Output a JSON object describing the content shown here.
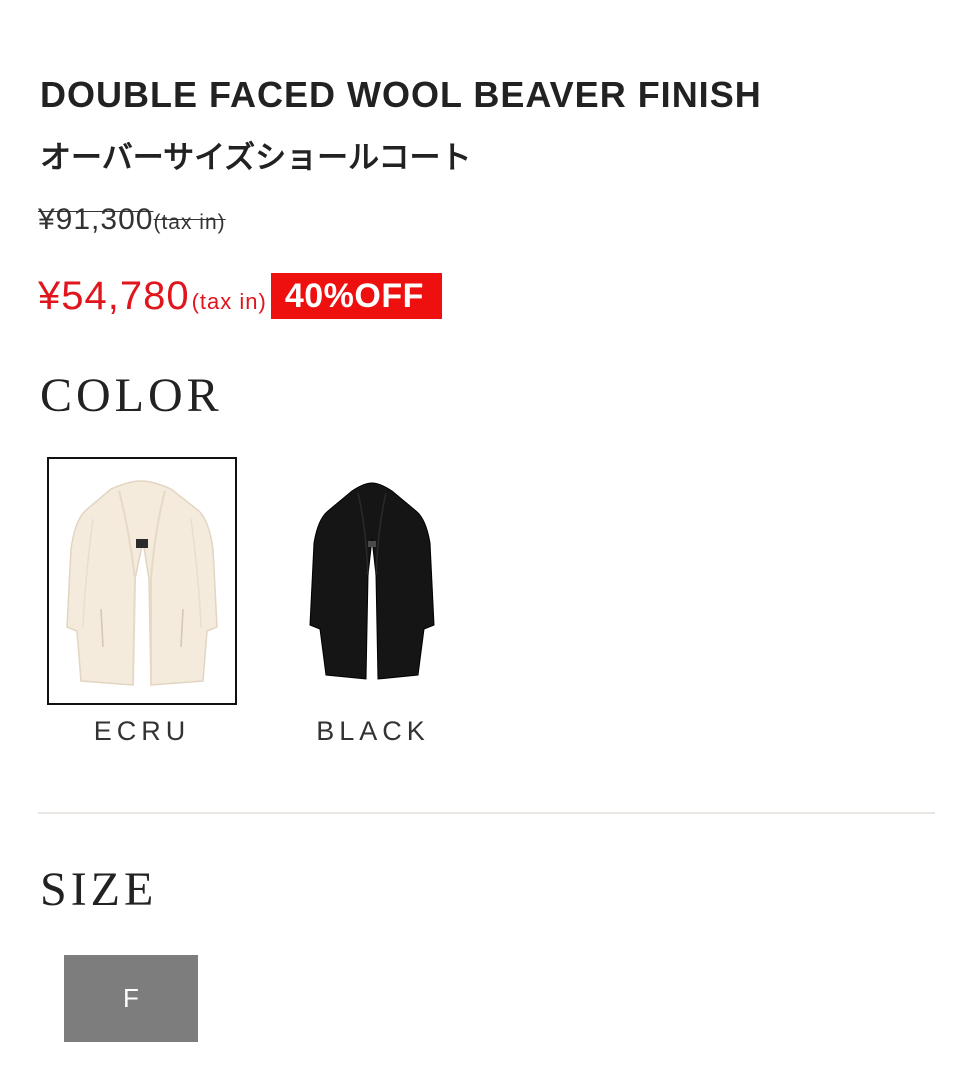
{
  "product": {
    "title_en": "DOUBLE FACED WOOL BEAVER FINISH",
    "title_jp": "オーバーサイズショールコート"
  },
  "pricing": {
    "original_price": "¥91,300",
    "original_tax_note": "(tax in)",
    "sale_price": "¥54,780",
    "sale_tax_note": "(tax in)",
    "discount_badge": "40%OFF",
    "sale_color": "#e0161d",
    "badge_color": "#ee0f0f"
  },
  "color_section": {
    "heading": "COLOR",
    "options": [
      {
        "label": "ECRU",
        "selected": true,
        "swatch_color": "#f4ebdd",
        "icon": "coat-ecru-thumbnail"
      },
      {
        "label": "BLACK",
        "selected": false,
        "swatch_color": "#151515",
        "icon": "coat-black-thumbnail"
      }
    ]
  },
  "size_section": {
    "heading": "SIZE",
    "options": [
      {
        "label": "F",
        "selected": true,
        "button_color": "#7d7d7d"
      }
    ]
  }
}
